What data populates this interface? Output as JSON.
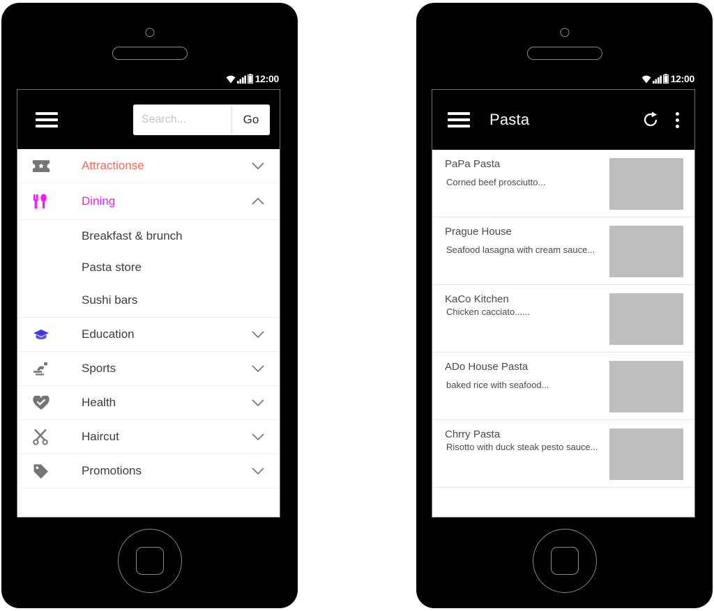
{
  "status_bar": {
    "time": "12:00",
    "icons": [
      "wifi-icon",
      "signal-icon",
      "battery-icon"
    ]
  },
  "left_phone": {
    "app_bar": {
      "menu_icon": "hamburger-icon",
      "search": {
        "placeholder": "Search...",
        "value": "",
        "go_label": "Go"
      }
    },
    "drawer": {
      "items": [
        {
          "label": "Attractionse",
          "icon": "ticket-icon",
          "color": "#fb6558",
          "expanded": false,
          "chevron": "chevron-down-icon",
          "children": []
        },
        {
          "label": "Dining",
          "icon": "cutlery-icon",
          "color": "#fd16fd",
          "expanded": true,
          "chevron": "chevron-up-icon",
          "children": [
            "Breakfast & brunch",
            "Pasta store",
            "Sushi bars"
          ]
        },
        {
          "label": "Education",
          "icon": "graduation-cap-icon",
          "color": "#3c3c3c",
          "expanded": false,
          "chevron": "chevron-down-icon",
          "children": []
        },
        {
          "label": "Sports",
          "icon": "sports-icon",
          "color": "#3c3c3c",
          "expanded": false,
          "chevron": "chevron-down-icon",
          "children": []
        },
        {
          "label": "Health",
          "icon": "heart-check-icon",
          "color": "#3c3c3c",
          "expanded": false,
          "chevron": "chevron-down-icon",
          "children": []
        },
        {
          "label": "Haircut",
          "icon": "scissors-icon",
          "color": "#3c3c3c",
          "expanded": false,
          "chevron": "chevron-down-icon",
          "children": []
        },
        {
          "label": "Promotions",
          "icon": "tag-icon",
          "color": "#3c3c3c",
          "expanded": false,
          "chevron": "chevron-down-icon",
          "children": []
        }
      ]
    },
    "nav_bar": {
      "back": "back-triangle-icon",
      "home": "home-circle-icon",
      "recents": "recents-square-icon"
    }
  },
  "right_phone": {
    "app_bar": {
      "menu_icon": "hamburger-icon",
      "title": "Pasta",
      "refresh_icon": "refresh-icon",
      "overflow_icon": "overflow-menu-icon"
    },
    "results": [
      {
        "title": "PaPa Pasta",
        "desc": "Corned beef prosciutto...",
        "thumb": "image-placeholder",
        "tight": false
      },
      {
        "title": "Prague House",
        "desc": "Seafood lasagna with cream sauce...",
        "thumb": "image-placeholder",
        "tight": false
      },
      {
        "title": "KaCo Kitchen",
        "desc": "Chicken cacciato......",
        "thumb": "image-placeholder",
        "tight": true
      },
      {
        "title": "ADo House Pasta",
        "desc": "baked rice with seafood...",
        "thumb": "image-placeholder",
        "tight": false
      },
      {
        "title": "Chrry Pasta",
        "desc": "Risotto with duck steak pesto sauce...",
        "thumb": "image-placeholder",
        "tight": true
      }
    ],
    "nav_bar": {
      "back": "back-triangle-icon",
      "home": "home-circle-icon",
      "recents": "recents-square-icon"
    }
  },
  "colors": {
    "accent_red": "#fb6558",
    "accent_magenta": "#fd16fd",
    "education_blue": "#3d3be8",
    "icon_gray": "#757575",
    "thumb_gray": "#bebebe"
  }
}
